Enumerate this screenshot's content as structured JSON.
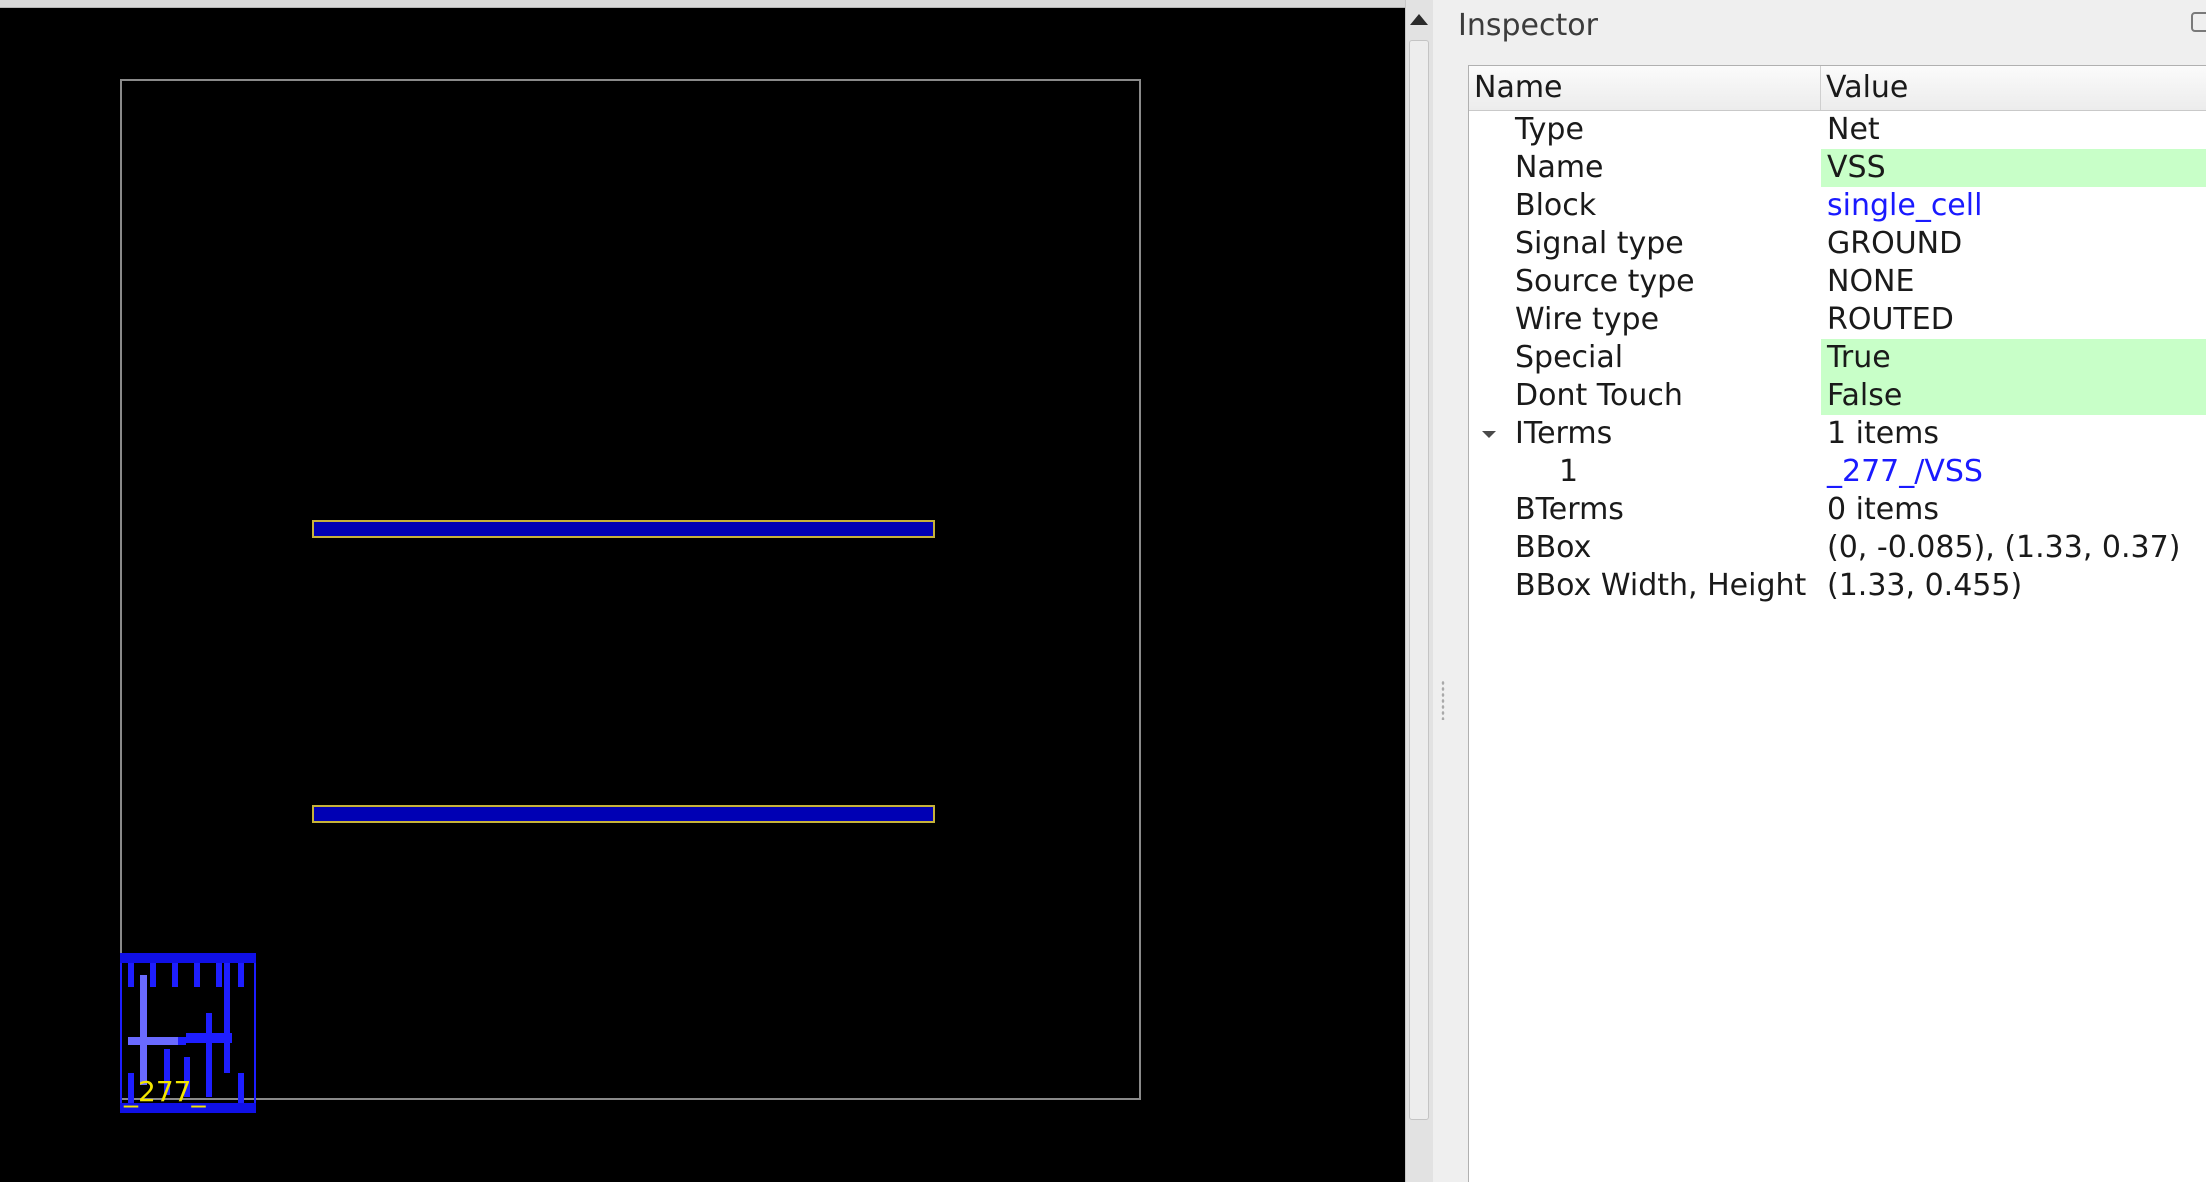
{
  "inspector": {
    "title": "Inspector",
    "columns": {
      "name": "Name",
      "value": "Value"
    },
    "rows": [
      {
        "name": "Type",
        "value": "Net"
      },
      {
        "name": "Name",
        "value": "VSS"
      },
      {
        "name": "Block",
        "value": "single_cell"
      },
      {
        "name": "Signal type",
        "value": "GROUND"
      },
      {
        "name": "Source type",
        "value": "NONE"
      },
      {
        "name": "Wire type",
        "value": "ROUTED"
      },
      {
        "name": "Special",
        "value": "True"
      },
      {
        "name": "Dont Touch",
        "value": "False"
      },
      {
        "name": "ITerms",
        "value": "1 items"
      },
      {
        "name": "1",
        "value": "_277_/VSS"
      },
      {
        "name": "BTerms",
        "value": "0 items"
      },
      {
        "name": "BBox",
        "value": "(0, -0.085), (1.33, 0.37)"
      },
      {
        "name": "BBox Width, Height",
        "value": "(1.33, 0.455)"
      }
    ]
  },
  "layout": {
    "instance_label": "_277_",
    "colors": {
      "background": "#000000",
      "rail_fill": "#0000b4",
      "rail_outline": "#c6b23a",
      "instance_label": "#f3e600",
      "editable_value_bg": "#c8ffc8",
      "link": "#1a1aff"
    }
  }
}
